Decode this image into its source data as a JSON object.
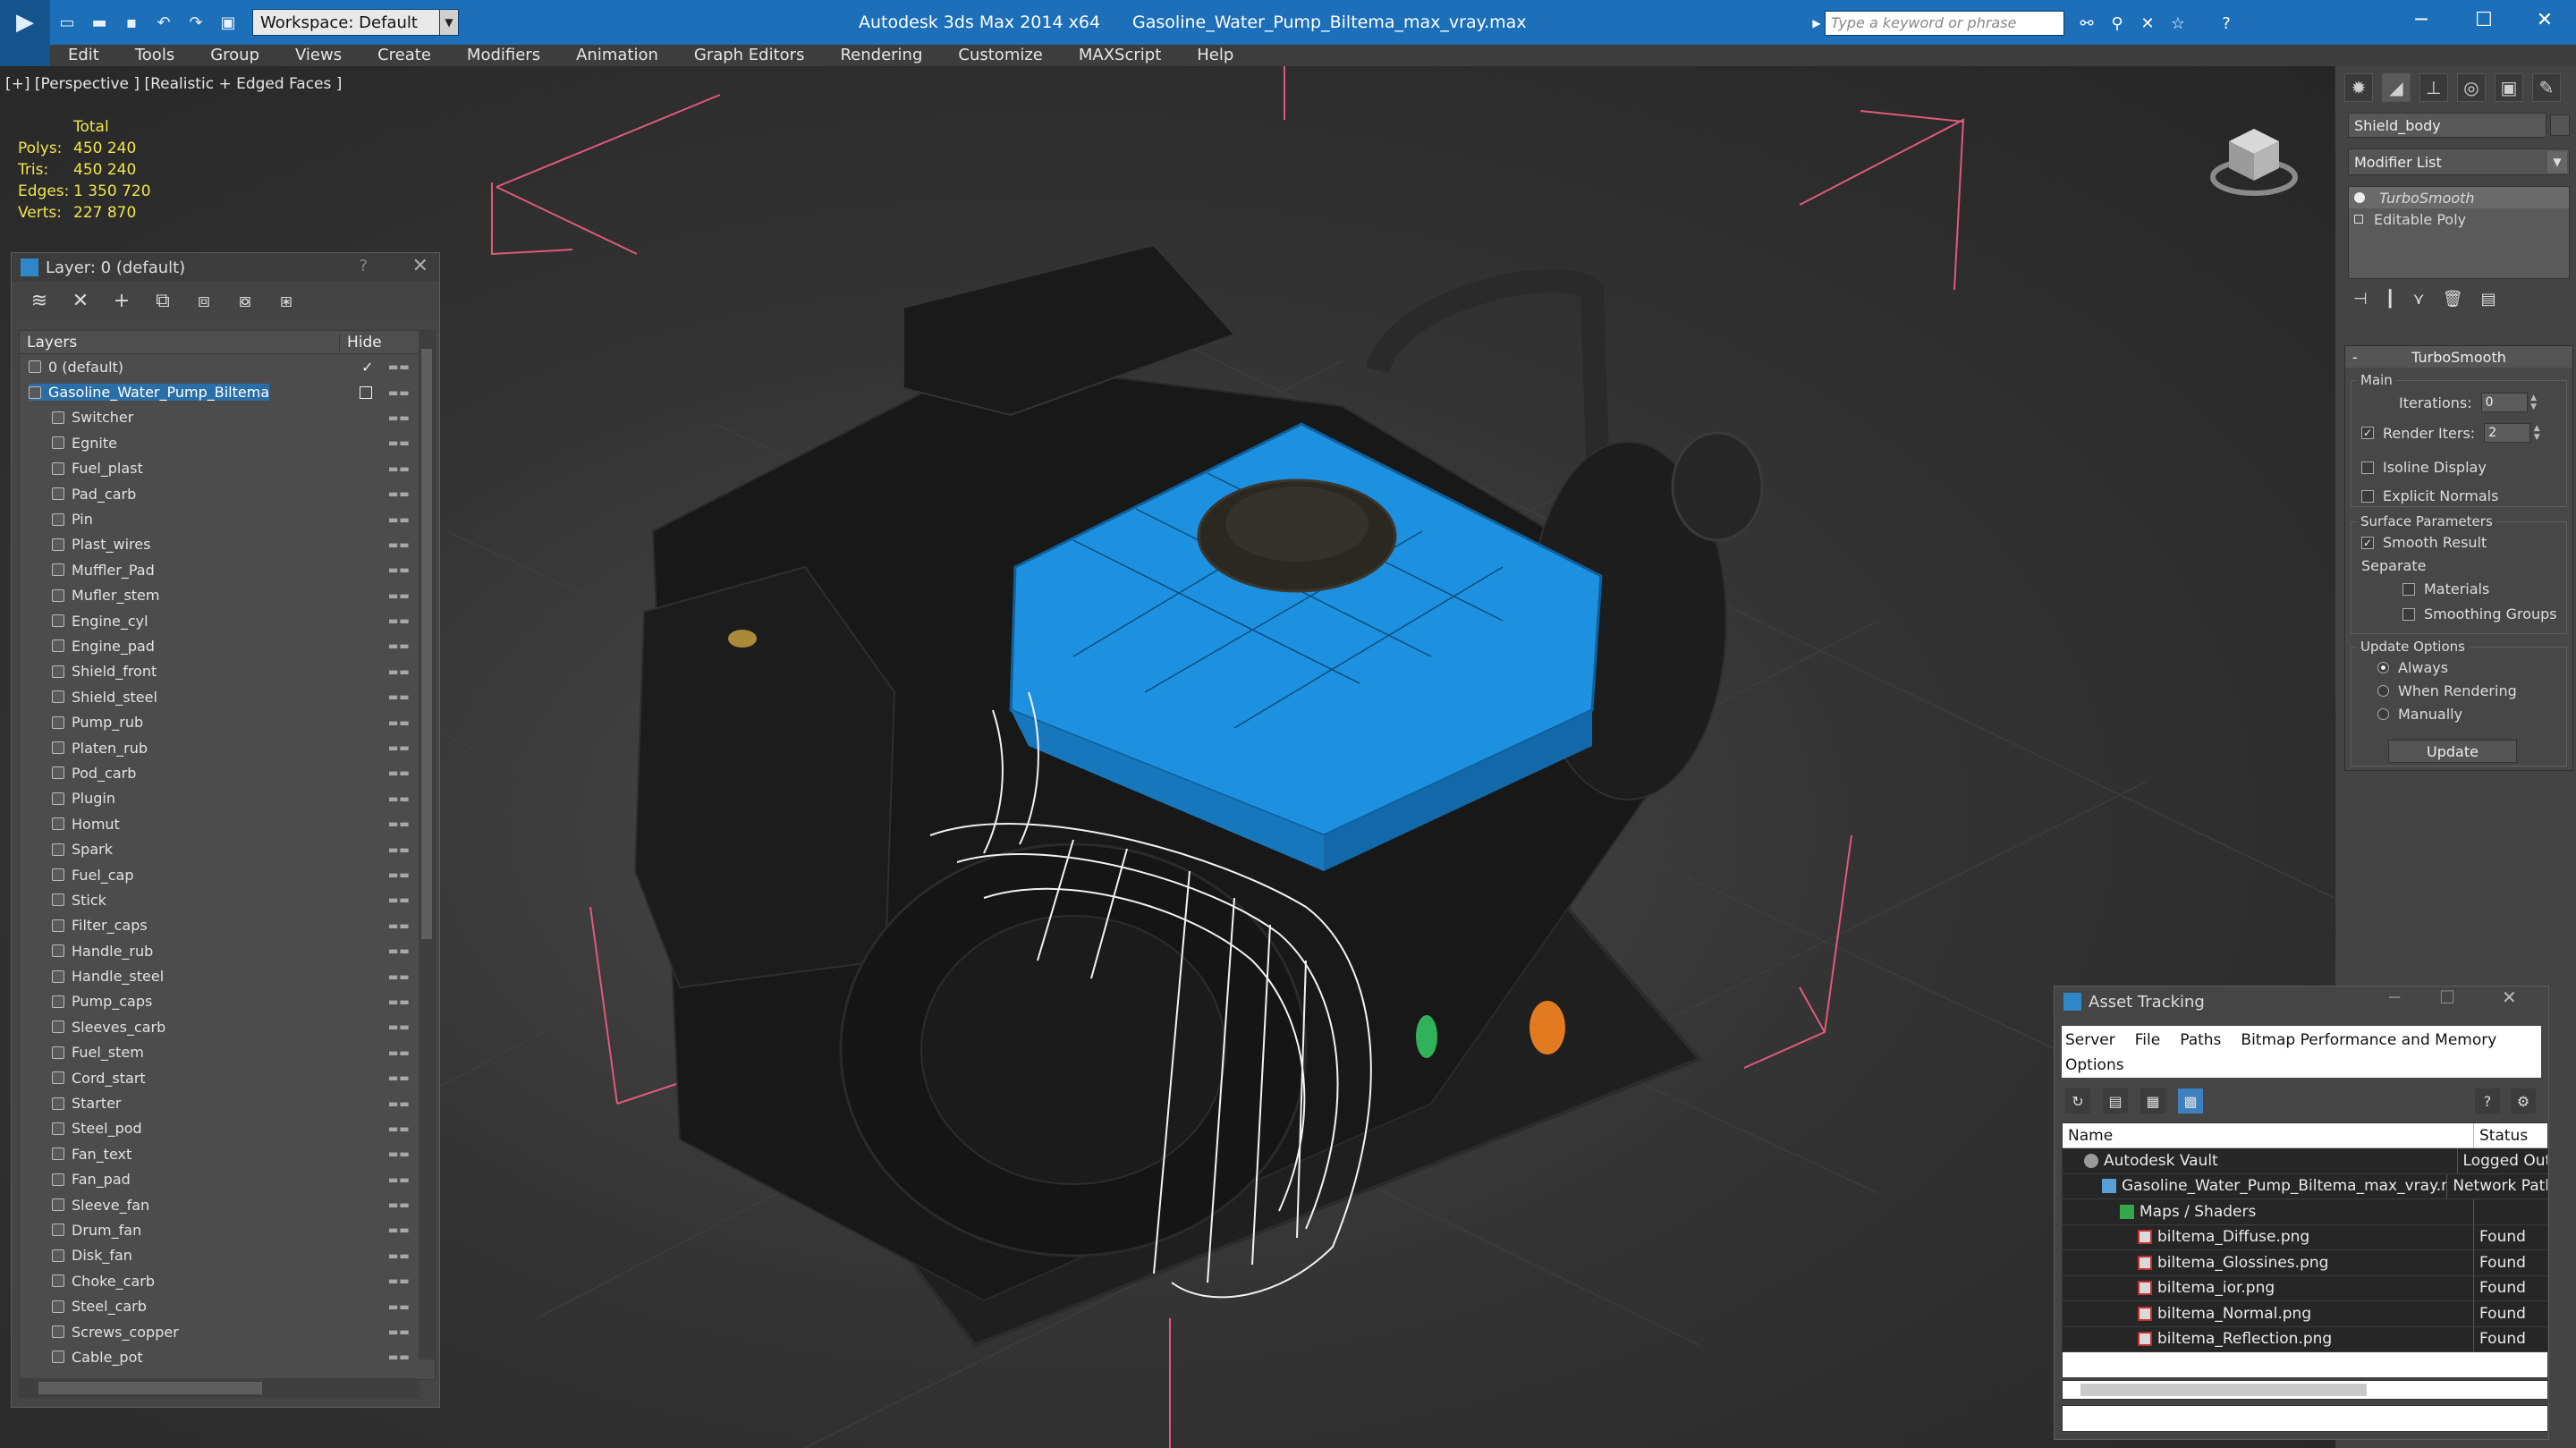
{
  "titlebar": {
    "workspace_label": "Workspace: Default",
    "app_name": "Autodesk 3ds Max  2014 x64",
    "file_name": "Gasoline_Water_Pump_Biltema_max_vray.max",
    "search_placeholder": "Type a keyword or phrase"
  },
  "menu": [
    "Edit",
    "Tools",
    "Group",
    "Views",
    "Create",
    "Modifiers",
    "Animation",
    "Graph Editors",
    "Rendering",
    "Customize",
    "MAXScript",
    "Help"
  ],
  "viewport": {
    "label": "[+] [Perspective ] [Realistic + Edged Faces ]",
    "stats": {
      "header": "Total",
      "rows": [
        {
          "label": "Polys:",
          "value": "450 240"
        },
        {
          "label": "Tris:",
          "value": "450 240"
        },
        {
          "label": "Edges:",
          "value": "1 350 720"
        },
        {
          "label": "Verts:",
          "value": "227 870"
        }
      ]
    }
  },
  "layer_explorer": {
    "title": "Layer: 0 (default)",
    "help": "?",
    "col_layers": "Layers",
    "col_hide": "Hide",
    "layers": [
      {
        "name": "0 (default)",
        "level": 0,
        "type": "layer",
        "checked": true
      },
      {
        "name": "Gasoline_Water_Pump_Biltema",
        "level": 0,
        "type": "layer",
        "selected": true
      },
      {
        "name": "Switcher",
        "level": 1,
        "type": "object"
      },
      {
        "name": "Egnite",
        "level": 1,
        "type": "object"
      },
      {
        "name": "Fuel_plast",
        "level": 1,
        "type": "object"
      },
      {
        "name": "Pad_carb",
        "level": 1,
        "type": "object"
      },
      {
        "name": "Pin",
        "level": 1,
        "type": "object"
      },
      {
        "name": "Plast_wires",
        "level": 1,
        "type": "object"
      },
      {
        "name": "Muffler_Pad",
        "level": 1,
        "type": "object"
      },
      {
        "name": "Mufler_stem",
        "level": 1,
        "type": "object"
      },
      {
        "name": "Engine_cyl",
        "level": 1,
        "type": "object"
      },
      {
        "name": "Engine_pad",
        "level": 1,
        "type": "object"
      },
      {
        "name": "Shield_front",
        "level": 1,
        "type": "object"
      },
      {
        "name": "Shield_steel",
        "level": 1,
        "type": "object"
      },
      {
        "name": "Pump_rub",
        "level": 1,
        "type": "object"
      },
      {
        "name": "Platen_rub",
        "level": 1,
        "type": "object"
      },
      {
        "name": "Pod_carb",
        "level": 1,
        "type": "object"
      },
      {
        "name": "Plugin",
        "level": 1,
        "type": "object"
      },
      {
        "name": "Homut",
        "level": 1,
        "type": "object"
      },
      {
        "name": "Spark",
        "level": 1,
        "type": "object"
      },
      {
        "name": "Fuel_cap",
        "level": 1,
        "type": "object"
      },
      {
        "name": "Stick",
        "level": 1,
        "type": "object"
      },
      {
        "name": "Filter_caps",
        "level": 1,
        "type": "object"
      },
      {
        "name": "Handle_rub",
        "level": 1,
        "type": "object"
      },
      {
        "name": "Handle_steel",
        "level": 1,
        "type": "object"
      },
      {
        "name": "Pump_caps",
        "level": 1,
        "type": "object"
      },
      {
        "name": "Sleeves_carb",
        "level": 1,
        "type": "object"
      },
      {
        "name": "Fuel_stem",
        "level": 1,
        "type": "object"
      },
      {
        "name": "Cord_start",
        "level": 1,
        "type": "object"
      },
      {
        "name": "Starter",
        "level": 1,
        "type": "object"
      },
      {
        "name": "Steel_pod",
        "level": 1,
        "type": "object"
      },
      {
        "name": "Fan_text",
        "level": 1,
        "type": "object"
      },
      {
        "name": "Fan_pad",
        "level": 1,
        "type": "object"
      },
      {
        "name": "Sleeve_fan",
        "level": 1,
        "type": "object"
      },
      {
        "name": "Drum_fan",
        "level": 1,
        "type": "object"
      },
      {
        "name": "Disk_fan",
        "level": 1,
        "type": "object"
      },
      {
        "name": "Choke_carb",
        "level": 1,
        "type": "object"
      },
      {
        "name": "Steel_carb",
        "level": 1,
        "type": "object"
      },
      {
        "name": "Screws_copper",
        "level": 1,
        "type": "object"
      },
      {
        "name": "Cable_pot",
        "level": 1,
        "type": "object"
      }
    ]
  },
  "command_panel": {
    "object_name": "Shield_body",
    "modifier_list": "Modifier List",
    "stack": [
      "TurboSmooth",
      "Editable Poly"
    ],
    "turbosmooth": {
      "title": "TurboSmooth",
      "main_group": "Main",
      "iterations_label": "Iterations:",
      "iterations_value": "0",
      "render_iters_label": "Render Iters:",
      "render_iters_value": "2",
      "isoline_display": "Isoline Display",
      "explicit_normals": "Explicit Normals",
      "surface_group": "Surface Parameters",
      "smooth_result": "Smooth Result",
      "separate_label": "Separate",
      "materials": "Materials",
      "smoothing_groups": "Smoothing Groups",
      "update_group": "Update Options",
      "always": "Always",
      "when_rendering": "When Rendering",
      "manually": "Manually",
      "update_button": "Update"
    }
  },
  "asset_tracking": {
    "title": "Asset Tracking",
    "menu_row1": [
      "Server",
      "File",
      "Paths",
      "Bitmap Performance and Memory"
    ],
    "menu_row2": [
      "Options"
    ],
    "col_name": "Name",
    "col_status": "Status",
    "rows": [
      {
        "name": "Autodesk Vault",
        "status": "Logged Out",
        "indent": 1,
        "icon": "vault"
      },
      {
        "name": "Gasoline_Water_Pump_Biltema_max_vray.max",
        "status": "Network Path",
        "indent": 2,
        "icon": "file"
      },
      {
        "name": "Maps / Shaders",
        "status": "",
        "indent": 3,
        "icon": "map"
      },
      {
        "name": "biltema_Diffuse.png",
        "status": "Found",
        "indent": 4,
        "icon": "png"
      },
      {
        "name": "biltema_Glossines.png",
        "status": "Found",
        "indent": 4,
        "icon": "png"
      },
      {
        "name": "biltema_ior.png",
        "status": "Found",
        "indent": 4,
        "icon": "png"
      },
      {
        "name": "biltema_Normal.png",
        "status": "Found",
        "indent": 4,
        "icon": "png"
      },
      {
        "name": "biltema_Reflection.png",
        "status": "Found",
        "indent": 4,
        "icon": "png"
      }
    ]
  },
  "colors": {
    "titlebar": "#1c6fb8",
    "selection": "#2a6ea8",
    "stats_text": "#f0e64b",
    "bbox_lines": "#e05a7a",
    "tank_blue": "#1e90e0"
  }
}
